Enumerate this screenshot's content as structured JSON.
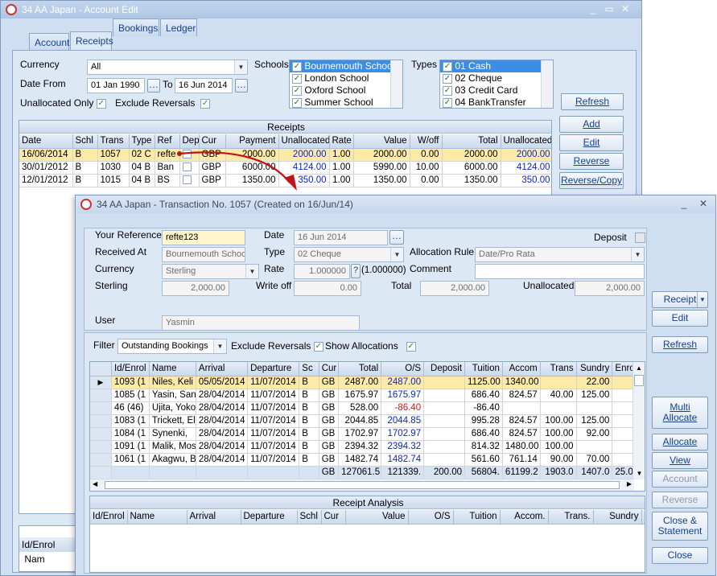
{
  "main_window": {
    "title": "34 AA Japan - Account Edit",
    "min": "_",
    "max": "▭",
    "close": "✕",
    "tabs": [
      "Account",
      "Receipts",
      "Bookings",
      "Ledger"
    ],
    "filters": {
      "currency_label": "Currency",
      "currency_value": "All",
      "date_from_label": "Date From",
      "date_from": "01 Jan 1990",
      "to_label": "To",
      "date_to": "16 Jun 2014",
      "unallocated_only_label": "Unallocated Only",
      "exclude_reversals_label": "Exclude Reversals",
      "schools_label": "Schools",
      "schools": [
        "Bournemouth School",
        "London School",
        "Oxford School",
        "Summer School"
      ],
      "types_label": "Types",
      "types": [
        "01 Cash",
        "02 Cheque",
        "03 Credit Card",
        "04 BankTransfer"
      ],
      "refresh": "Refresh"
    },
    "receipts_caption": "Receipts",
    "receipts_columns": [
      "Date",
      "Schl",
      "Trans",
      "Type",
      "Ref",
      "Dep",
      "Cur",
      "Payment",
      "Unallocated",
      "Rate",
      "Value",
      "W/off",
      "Total",
      "Unallocated"
    ],
    "receipts_rows": [
      [
        "16/06/2014",
        "B",
        "1057",
        "02 C",
        "refte",
        "",
        "GBP",
        "2000.00",
        "2000.00",
        "1.00",
        "2000.00",
        "0.00",
        "2000.00",
        "2000.00"
      ],
      [
        "30/01/2012",
        "B",
        "1030",
        "04 B",
        "Ban",
        "",
        "GBP",
        "6000.00",
        "4124.00",
        "1.00",
        "5990.00",
        "10.00",
        "6000.00",
        "4124.00"
      ],
      [
        "12/01/2012",
        "B",
        "1015",
        "04 B",
        "BS",
        "",
        "GBP",
        "1350.00",
        "350.00",
        "1.00",
        "1350.00",
        "0.00",
        "1350.00",
        "350.00"
      ]
    ],
    "side_buttons": [
      "Add",
      "Edit",
      "Reverse",
      "Reverse/Copy"
    ],
    "bottom_grid_columns": [
      "Id/Enrol",
      "Nam"
    ]
  },
  "dialog": {
    "title": "34 AA Japan - Transaction No. 1057 (Created on 16/Jun/14)",
    "min": "_",
    "close": "✕",
    "your_reference_label": "Your Reference",
    "your_reference": "refte123",
    "date_label": "Date",
    "date": "16 Jun 2014",
    "deposit_label": "Deposit",
    "received_at_label": "Received At",
    "received_at": "Bournemouth School",
    "type_label": "Type",
    "type": "02 Cheque",
    "allocation_rule_label": "Allocation Rule",
    "allocation_rule": "Date/Pro Rata",
    "currency_label": "Currency",
    "currency": "Sterling",
    "rate_label": "Rate",
    "rate": "1.000000",
    "rate_help": "?",
    "rate_inverse": "(1.000000)",
    "comment_label": "Comment",
    "comment": "",
    "sterling_label": "Sterling",
    "sterling": "2,000.00",
    "write_off_label": "Write off",
    "write_off": "0.00",
    "total_label": "Total",
    "total": "2,000.00",
    "unallocated_label": "Unallocated",
    "unallocated": "2,000.00",
    "user_label": "User",
    "user": "Yasmin",
    "receipt_button": "Receipt",
    "edit_button": "Edit",
    "filter_label": "Filter",
    "filter_value": "Outstanding Bookings",
    "exclude_reversals_label": "Exclude Reversals",
    "show_allocations_label": "Show Allocations",
    "refresh_button": "Refresh",
    "alloc_columns": [
      "Id/Enrol",
      "Name",
      "Arrival",
      "Departure",
      "Sc",
      "Cur",
      "Total",
      "O/S",
      "Deposit",
      "Tuition",
      "Accom",
      "Trans",
      "Sundry",
      "Enro"
    ],
    "alloc_rows": [
      [
        "1093 (1",
        "Niles, Keli",
        "05/05/2014",
        "11/07/2014",
        "B",
        "GB",
        "2487.00",
        "2487.00",
        "",
        "1125.00",
        "1340.00",
        "",
        "22.00"
      ],
      [
        "1085 (1",
        "Yasin, San",
        "28/04/2014",
        "11/07/2014",
        "B",
        "GB",
        "1675.97",
        "1675.97",
        "",
        "686.40",
        "824.57",
        "40.00",
        "125.00"
      ],
      [
        "46 (46)",
        "Ujita, Yoko",
        "28/04/2014",
        "11/07/2014",
        "B",
        "GB",
        "528.00",
        "-86.40",
        "",
        "-86.40",
        "",
        "",
        ""
      ],
      [
        "1083 (1",
        "Trickett, El",
        "28/04/2014",
        "11/07/2014",
        "B",
        "GB",
        "2044.85",
        "2044.85",
        "",
        "995.28",
        "824.57",
        "100.00",
        "125.00"
      ],
      [
        "1084 (1",
        "Synenki,",
        "28/04/2014",
        "11/07/2014",
        "B",
        "GB",
        "1702.97",
        "1702.97",
        "",
        "686.40",
        "824.57",
        "100.00",
        "92.00"
      ],
      [
        "1091 (1",
        "Malik, Mos",
        "28/04/2014",
        "11/07/2014",
        "B",
        "GB",
        "2394.32",
        "2394.32",
        "",
        "814.32",
        "1480.00",
        "100.00",
        ""
      ],
      [
        "1061 (1",
        "Akagwu, B",
        "28/04/2014",
        "11/07/2014",
        "B",
        "GB",
        "1482.74",
        "1482.74",
        "",
        "561.60",
        "761.14",
        "90.00",
        "70.00"
      ]
    ],
    "alloc_totals": [
      "",
      "",
      "",
      "",
      "",
      "GB",
      "127061.5",
      "121339.",
      "200.00",
      "56804.",
      "61199.2",
      "1903.0",
      "1407.0",
      "25.0"
    ],
    "right_buttons": [
      "Multi Allocate",
      "Allocate",
      "View",
      "Account",
      "Reverse",
      "Close & Statement",
      "Close"
    ],
    "analysis_caption": "Receipt Analysis",
    "analysis_columns": [
      "Id/Enrol",
      "Name",
      "Arrival",
      "Departure",
      "Schl",
      "Cur",
      "Value",
      "O/S",
      "Tuition",
      "Accom.",
      "Trans.",
      "Sundry",
      "Enrol"
    ]
  },
  "colors": {
    "window_bg": "#cfdff1",
    "selected_row": "#fde9a8",
    "highlight": "#3a8ee6",
    "arrow": "#c0141a",
    "link_blue": "#0b25c9",
    "negative_red": "#e01010"
  }
}
